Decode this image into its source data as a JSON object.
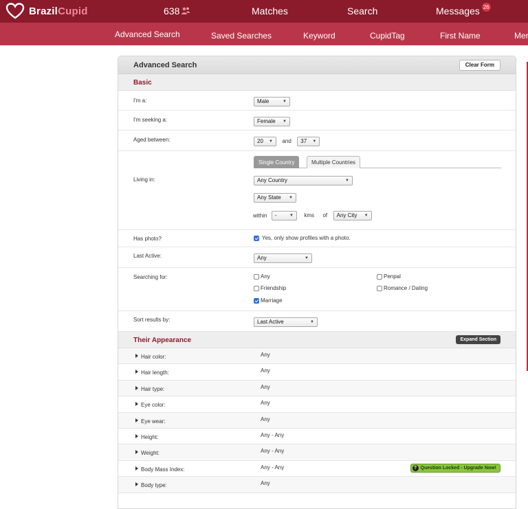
{
  "brand": {
    "part1": "Brazil",
    "part2": "Cupid",
    "accent": "#8b1a2b"
  },
  "topnav": {
    "points": "638",
    "matches": "Matches",
    "search": "Search",
    "messages": "Messages",
    "messages_count": "26"
  },
  "subnav": [
    "Advanced Search",
    "Saved Searches",
    "Keyword",
    "CupidTag",
    "First Name",
    "Mer"
  ],
  "panel": {
    "title": "Advanced Search",
    "clear_label": "Clear Form"
  },
  "basic": {
    "title": "Basic",
    "im_a": {
      "label": "I'm a:",
      "value": "Male"
    },
    "seeking": {
      "label": "I'm seeking a:",
      "value": "Female"
    },
    "aged": {
      "label": "Aged between:",
      "min": "20",
      "and": "and",
      "max": "37"
    },
    "living": {
      "label": "Living in:",
      "tab_single": "Single Country",
      "tab_multiple": "Multiple Countries",
      "country": "Any Country",
      "state": "Any State",
      "within": "within",
      "distance": "-",
      "kms": "kms",
      "of": "of",
      "city": "Any City"
    },
    "photo": {
      "label": "Has photo?",
      "option": "Yes, only show profiles with a photo."
    },
    "last_active": {
      "label": "Last Active:",
      "value": "Any"
    },
    "searching_for": {
      "label": "Searching for:",
      "options": [
        "Any",
        "Penpal",
        "Friendship",
        "Romance / Dating",
        "Marriage"
      ]
    },
    "sort": {
      "label": "Sort results by:",
      "value": "Last Active"
    }
  },
  "appearance": {
    "title": "Their Appearance",
    "expand_label": "Expand Section",
    "locked_label": "Question Locked - Upgrade Now!",
    "rows": [
      {
        "label": "Hair color:",
        "value": "Any"
      },
      {
        "label": "Hair length:",
        "value": "Any"
      },
      {
        "label": "Hair type:",
        "value": "Any"
      },
      {
        "label": "Eye color:",
        "value": "Any"
      },
      {
        "label": "Eye wear:",
        "value": "Any"
      },
      {
        "label": "Height:",
        "value": "Any - Any"
      },
      {
        "label": "Weight:",
        "value": "Any - Any"
      },
      {
        "label": "Body Mass Index:",
        "value": "Any - Any"
      },
      {
        "label": "Body type:",
        "value": "Any"
      }
    ]
  }
}
